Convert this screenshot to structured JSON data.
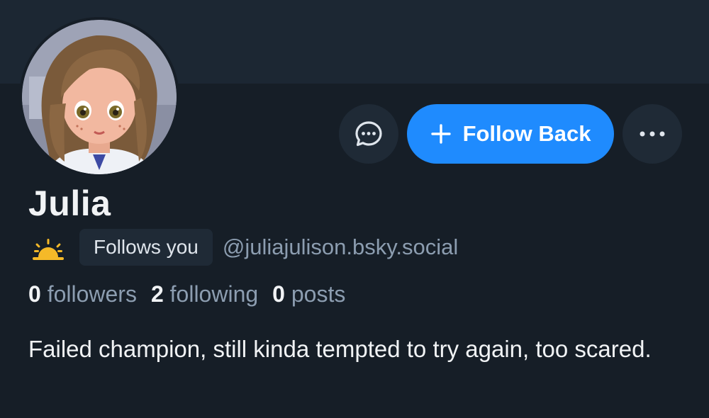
{
  "profile": {
    "display_name": "Julia",
    "follows_you_label": "Follows you",
    "handle": "@juliajulison.bsky.social",
    "bio": "Failed champion, still kinda tempted to try again, too scared.",
    "status_emoji": "sunrise-icon",
    "avatar": "avatar-image"
  },
  "stats": {
    "followers_count": "0",
    "followers_label": "followers",
    "following_count": "2",
    "following_label": "following",
    "posts_count": "0",
    "posts_label": "posts"
  },
  "actions": {
    "message_icon": "chat-bubble-icon",
    "follow_back_label": "Follow Back",
    "more_icon": "ellipsis-icon"
  },
  "colors": {
    "background": "#161e27",
    "banner": "#1c2733",
    "accent": "#1f8bfe",
    "muted_text": "#8c9db0"
  }
}
